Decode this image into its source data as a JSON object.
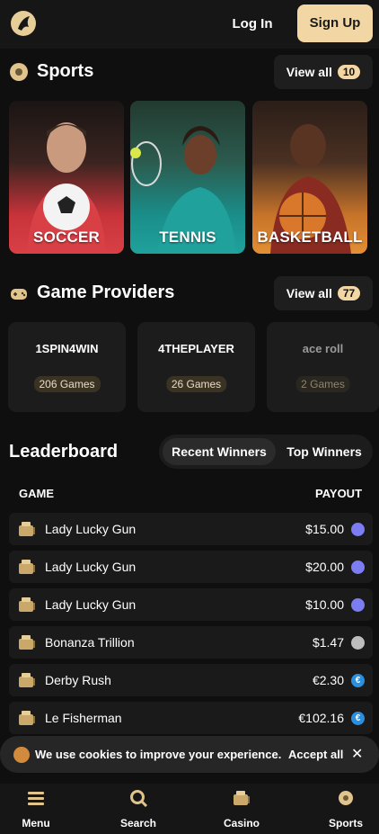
{
  "header": {
    "login_label": "Log In",
    "signup_label": "Sign Up"
  },
  "sports": {
    "title": "Sports",
    "view_all": "View all",
    "count": "10",
    "cards": [
      {
        "label": "SOCCER"
      },
      {
        "label": "TENNIS"
      },
      {
        "label": "BASKETBALL"
      }
    ]
  },
  "providers": {
    "title": "Game Providers",
    "view_all": "View all",
    "count": "77",
    "items": [
      {
        "logo_text": "1SPIN4WIN",
        "games": "206 Games"
      },
      {
        "logo_text": "4THEPLAYER",
        "games": "26 Games"
      },
      {
        "logo_text": "ace roll",
        "games": "2 Games"
      }
    ]
  },
  "leaderboard": {
    "title": "Leaderboard",
    "tabs": [
      "Recent Winners",
      "Top Winners"
    ],
    "col_game": "GAME",
    "col_payout": "PAYOUT",
    "rows": [
      {
        "game": "Lady Lucky Gun",
        "payout": "$15.00",
        "coin": "eth"
      },
      {
        "game": "Lady Lucky Gun",
        "payout": "$20.00",
        "coin": "eth"
      },
      {
        "game": "Lady Lucky Gun",
        "payout": "$10.00",
        "coin": "eth"
      },
      {
        "game": "Bonanza Trillion",
        "payout": "$1.47",
        "coin": "ltc"
      },
      {
        "game": "Derby Rush",
        "payout": "€2.30",
        "coin": "eur"
      },
      {
        "game": "Le Fisherman",
        "payout": "€102.16",
        "coin": "eur"
      }
    ]
  },
  "cookie": {
    "text": "We use cookies to improve your experience.",
    "accept_label": "Accept all",
    "close_label": "✕"
  },
  "bottom_nav": [
    "Menu",
    "Search",
    "Casino",
    "Sports"
  ],
  "colors": {
    "accent": "#f2d6a3",
    "background": "#0f0f10",
    "card": "#1a1a1a"
  }
}
